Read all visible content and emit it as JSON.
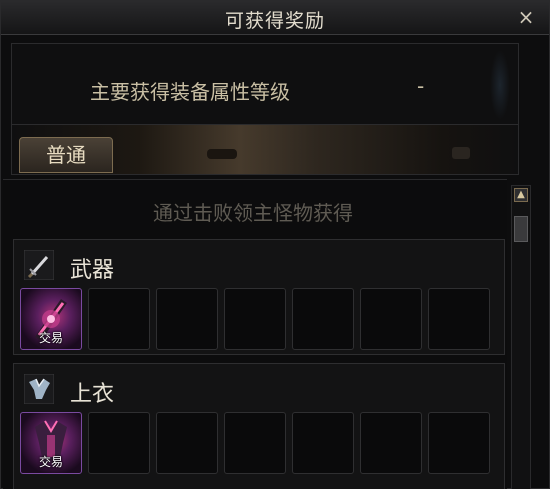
{
  "window": {
    "title": "可获得奖励",
    "close_glyph": "×"
  },
  "header": {
    "label": "主要获得装备属性等级",
    "value": "-"
  },
  "tabs": [
    {
      "label": "普通",
      "selected": true
    }
  ],
  "source_text": "通过击败领主怪物获得",
  "categories": [
    {
      "name": "武器",
      "icon": "sword-icon",
      "items": [
        {
          "tag": "交易",
          "icon": "weapon-item-icon"
        }
      ],
      "slot_count": 7
    },
    {
      "name": "上衣",
      "icon": "armor-top-icon",
      "items": [
        {
          "tag": "交易",
          "icon": "armor-item-icon"
        }
      ],
      "slot_count": 7
    }
  ],
  "colors": {
    "accent_gold": "#7d6c50",
    "item_rare_purple": "#7a4aa0",
    "text_muted": "#5f5b53"
  }
}
